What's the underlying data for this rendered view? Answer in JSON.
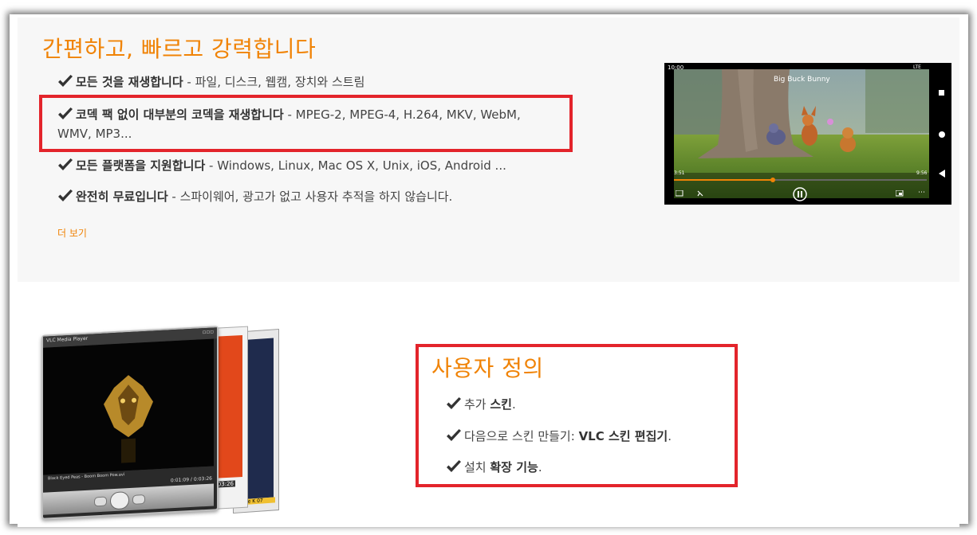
{
  "section1": {
    "title": "간편하고, 빠르고 강력합니다",
    "features": [
      {
        "bold": "모든 것을 재생합니다",
        "rest": " - 파일, 디스크, 웹캠, 장치와 스트림"
      },
      {
        "bold": "코덱 팩 없이 대부분의 코덱을 재생합니다",
        "rest": " - MPEG-2, MPEG-4, H.264, MKV, WebM,",
        "rest2": "WMV, MP3..."
      },
      {
        "bold": "모든 플랫폼을 지원합니다",
        "rest": " - Windows, Linux, Mac OS X, Unix, iOS, Android ..."
      },
      {
        "bold": "완전히 무료입니다",
        "rest": " - 스파이웨어, 광고가 없고 사용자 추적을 하지 않습니다."
      }
    ],
    "more_link": "더 보기"
  },
  "video": {
    "status_time": "10:00",
    "status_right": "LTE",
    "movie_title": "Big Buck Bunny",
    "elapsed": "3:51",
    "duration": "9:56",
    "progress": 0.39
  },
  "skin_player": {
    "window_title": "VLC Media Player",
    "track": "Black Eyed Peas - Boom Boom Pow.avi",
    "time": "0:01:09 / 0:03:26",
    "time_back": "0:03:26",
    "label_back": "for The K",
    "label_back2": "07"
  },
  "section2": {
    "title": "사용자 정의",
    "items": [
      {
        "pre": "추가 ",
        "bold": "스킨",
        "post": "."
      },
      {
        "pre": "다음으로 스킨 만들기: ",
        "bold": "VLC 스킨 편집기",
        "post": "."
      },
      {
        "pre": "설치 ",
        "bold": "확장 기능",
        "post": "."
      }
    ]
  },
  "colors": {
    "accent": "#f08306",
    "highlight_box": "#e3242b"
  }
}
